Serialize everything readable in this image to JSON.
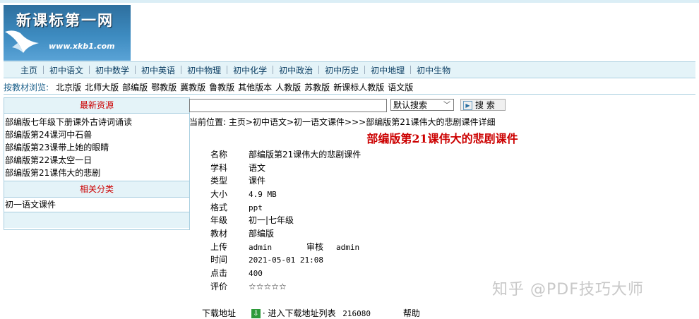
{
  "header": {
    "logo_title": "新课标第一网",
    "logo_url": "www.xkb1.com"
  },
  "nav_main": [
    "主页",
    "初中语文",
    "初中数学",
    "初中英语",
    "初中物理",
    "初中化学",
    "初中政治",
    "初中历史",
    "初中地理",
    "初中生物"
  ],
  "nav_editions": {
    "label": "按教材浏览:",
    "items": [
      "北京版",
      "北师大版",
      "部编版",
      "鄂教版",
      "冀教版",
      "鲁教版",
      "其他版本",
      "人教版",
      "苏教版",
      "新课标人教版",
      "语文版"
    ]
  },
  "sidebar": {
    "latest_title": "最新资源",
    "latest_items": [
      "部编版七年级下册课外古诗词诵读",
      "部编版第24课河中石兽",
      "部编版第23课带上她的眼睛",
      "部编版第22课太空一日",
      "部编版第21课伟大的悲剧"
    ],
    "related_title": "相关分类",
    "related_items": [
      "初一语文课件"
    ]
  },
  "search": {
    "input_value": "",
    "select_value": "默认搜索",
    "button_label": "搜 索"
  },
  "breadcrumb": {
    "prefix": "当前位置: ",
    "home": "主页",
    "sep1": ">",
    "cat1": "初中语文",
    "sep2": ">",
    "cat2": "初一语文课件",
    "sep3": ">>>",
    "current": "部编版第21课伟大的悲剧课件详细"
  },
  "detail": {
    "title": "部编版第21课伟大的悲剧课件",
    "fields": {
      "name_k": "名称",
      "name_v": "部编版第21课伟大的悲剧课件",
      "subject_k": "学科",
      "subject_v": "语文",
      "type_k": "类型",
      "type_v": "课件",
      "size_k": "大小",
      "size_v": "4.9 MB",
      "format_k": "格式",
      "format_v": "ppt",
      "grade_k": "年级",
      "grade_v": "初一|七年级",
      "textbook_k": "教材",
      "textbook_v": "部编版",
      "upload_k": "上传",
      "upload_v": "admin",
      "review_k": "审核",
      "review_v": "admin",
      "time_k": "时间",
      "time_v": "2021-05-01 21:08",
      "hits_k": "点击",
      "hits_v": "400",
      "rating_k": "评价",
      "rating_v": "☆☆☆☆☆"
    },
    "download_k": "下载地址",
    "download_link": "· 进入下载地址列表",
    "download_count": "216080",
    "help": "帮助"
  },
  "watermark": "知乎 @PDF技巧大师"
}
